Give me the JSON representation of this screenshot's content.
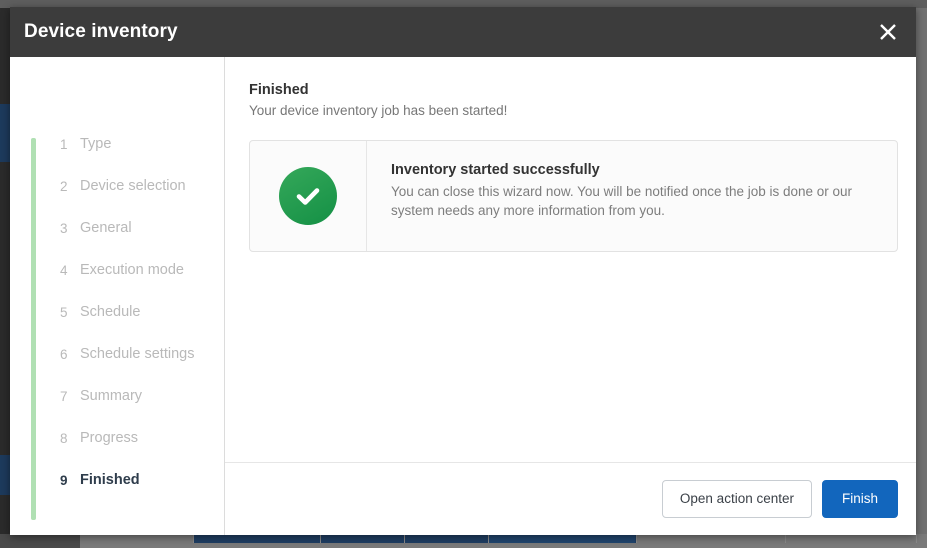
{
  "window": {
    "title": "Device inventory",
    "close_icon": "close-icon"
  },
  "sidebar": {
    "steps": [
      {
        "num": "1",
        "label": "Type",
        "current": false
      },
      {
        "num": "2",
        "label": "Device selection",
        "current": false
      },
      {
        "num": "3",
        "label": "General",
        "current": false
      },
      {
        "num": "4",
        "label": "Execution mode",
        "current": false
      },
      {
        "num": "5",
        "label": "Schedule",
        "current": false
      },
      {
        "num": "6",
        "label": "Schedule settings",
        "current": false
      },
      {
        "num": "7",
        "label": "Summary",
        "current": false
      },
      {
        "num": "8",
        "label": "Progress",
        "current": false
      },
      {
        "num": "9",
        "label": "Finished",
        "current": true
      }
    ],
    "rail_color": "#b0e0b3"
  },
  "main": {
    "section_title": "Finished",
    "section_subtitle": "Your device inventory job has been started!",
    "card": {
      "icon": "success-check-icon",
      "icon_color": "#149045",
      "title": "Inventory started successfully",
      "description": "You can close this wizard now. You will be notified once the job is done or our system needs any more information from you."
    }
  },
  "footer": {
    "secondary_button": "Open action center",
    "primary_button": "Finish",
    "primary_color": "#1266bd"
  }
}
